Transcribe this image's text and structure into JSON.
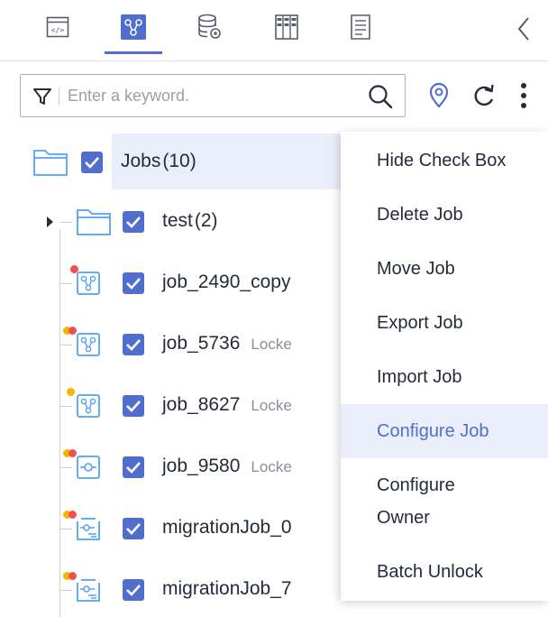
{
  "tabs": [
    {
      "name": "code-tab",
      "icon": "code-icon",
      "active": false
    },
    {
      "name": "jobs-tab",
      "icon": "job-flow-icon",
      "active": true
    },
    {
      "name": "database-tab",
      "icon": "database-icon",
      "active": false
    },
    {
      "name": "grid-tab",
      "icon": "table-grid-icon",
      "active": false
    },
    {
      "name": "document-tab",
      "icon": "document-icon",
      "active": false
    }
  ],
  "search": {
    "placeholder": "Enter a keyword."
  },
  "colors": {
    "accent": "#526ecc",
    "hover_bg": "#e9eefa",
    "dot_red": "#ee5252",
    "dot_yellow": "#f7b300"
  },
  "tree": {
    "root": {
      "label": "Jobs",
      "count": "(10)"
    },
    "items": [
      {
        "label": "test",
        "count": "(2)",
        "type": "folder"
      },
      {
        "label": "job_2490_copy",
        "lock": "",
        "icon": "workflow-icon",
        "dots": [
          "red"
        ]
      },
      {
        "label": "job_5736",
        "lock": "Locke",
        "icon": "workflow-icon",
        "dots": [
          "yellow",
          "red"
        ]
      },
      {
        "label": "job_8627",
        "lock": "Locke",
        "icon": "workflow-icon",
        "dots": [
          "yellow"
        ]
      },
      {
        "label": "job_9580",
        "lock": "Locke",
        "icon": "pipeline-icon",
        "dots": [
          "yellow",
          "red"
        ]
      },
      {
        "label": "migrationJob_0",
        "lock": "",
        "icon": "migration-icon",
        "dots": [
          "yellow",
          "red"
        ]
      },
      {
        "label": "migrationJob_7",
        "lock": "",
        "icon": "migration-icon",
        "dots": [
          "yellow",
          "red"
        ]
      }
    ]
  },
  "menu": {
    "items": [
      {
        "label": "Hide Check Box"
      },
      {
        "label": "Delete Job"
      },
      {
        "label": "Move Job"
      },
      {
        "label": "Export Job"
      },
      {
        "label": "Import Job"
      },
      {
        "label": "Configure Job"
      },
      {
        "label": "Configure",
        "label2": "Owner"
      },
      {
        "label": "Batch Unlock"
      }
    ],
    "highlighted": "Configure Job"
  }
}
